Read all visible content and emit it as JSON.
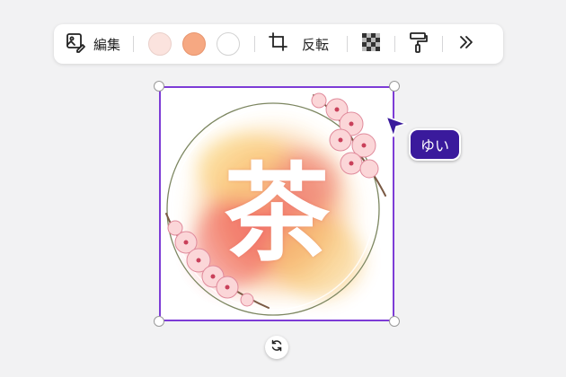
{
  "toolbar": {
    "edit_label": "編集",
    "flip_label": "反転",
    "swatches": [
      "#fbe3de",
      "#f6a882",
      "#ffffff"
    ],
    "icons": [
      "image-edit-icon",
      "crop-icon",
      "transparency-icon",
      "paint-roller-icon",
      "more-icon"
    ]
  },
  "canvas": {
    "kanji": "茶",
    "accent": "#7d3cd6"
  },
  "collaborator": {
    "name": "ゆい",
    "color": "#3a1a9c"
  }
}
